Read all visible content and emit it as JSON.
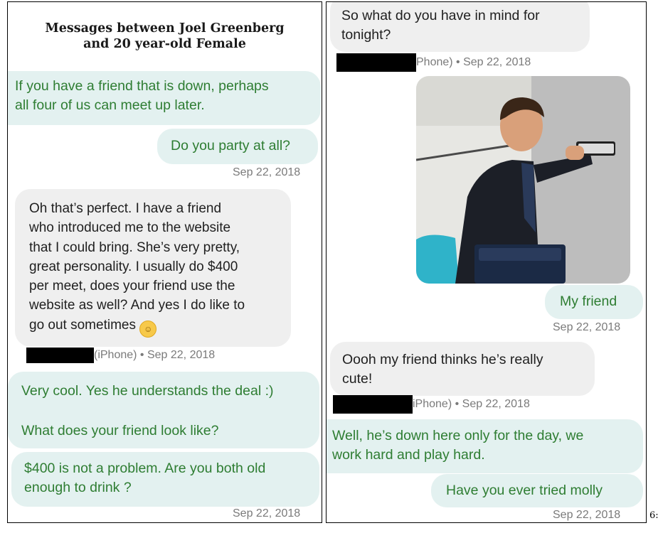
{
  "left": {
    "title_line1": "Messages between Joel Greenberg",
    "title_line2": "and 20 year-old Female",
    "m1_line1": "If you have a friend that is down, perhaps",
    "m1_line2": "all four of us can meet up later.",
    "m2": "Do you party at all?",
    "m2_time": "Sep 22, 2018",
    "m3_lines": [
      "Oh that’s perfect. I have a friend",
      "who introduced me to the website",
      "that I could bring. She’s very pretty,",
      "great personality. I usually do $400",
      "per meet, does your friend use the",
      "website as well? And yes I do like to",
      "go out sometimes"
    ],
    "m3_emoji": "☺",
    "m3_meta": "(iPhone) • Sep 22, 2018",
    "m4_line1": "Very cool. Yes he understands the deal :)",
    "m4_line2": "What does your friend look like?",
    "m5_line1": "$400 is not a problem. Are you both old",
    "m5_line2": "enough to drink ?",
    "m5_time": "Sep 22, 2018"
  },
  "right": {
    "m1_line1": "So what do you have in mind for",
    "m1_line2": "tonight?",
    "m1_meta": "Phone) • Sep 22, 2018",
    "m2": "My friend",
    "m2_time": "Sep 22, 2018",
    "m3_line1": "Oooh my friend thinks he’s really",
    "m3_line2": "cute!",
    "m3_meta": "iPhone) • Sep 22, 2018",
    "m4_line1": "Well, he’s down here only for the day, we",
    "m4_line2": "work hard and play hard.",
    "m5": "Have you ever tried molly",
    "m5_time": "Sep 22, 2018"
  },
  "page_number": "6:",
  "colors": {
    "outgoing_bubble": "#e3f1f0",
    "outgoing_text": "#2e7d32",
    "incoming_bubble": "#efefef",
    "redaction": "#000000"
  }
}
